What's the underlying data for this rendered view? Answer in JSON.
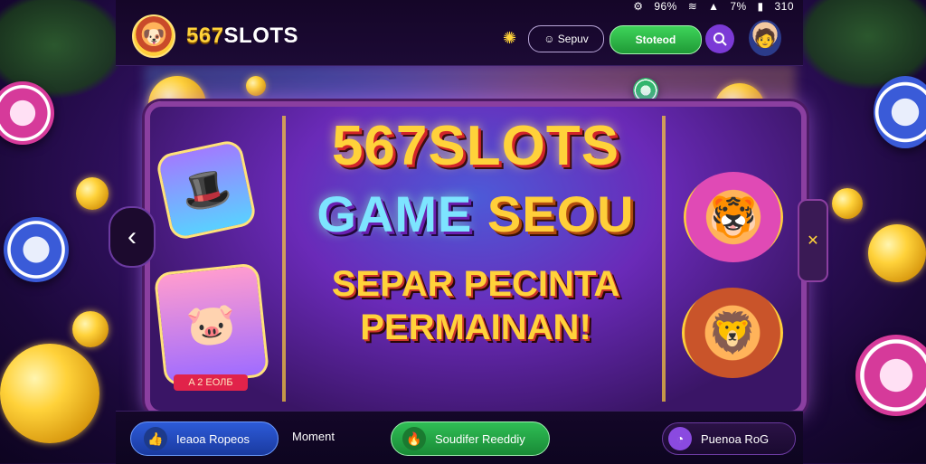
{
  "status_bar": {
    "icon1": "settings-cog-icon",
    "value1": "96%",
    "wifi_icon": "wifi-icon",
    "signal_icon": "signal-icon",
    "value2": "7%",
    "battery_icon": "battery-icon",
    "time": "310"
  },
  "header": {
    "brand_number": "567",
    "brand_name": "SLOTS",
    "signup_label": "☺ Sepuv",
    "login_label": "Stoteod",
    "search_icon": "search-icon"
  },
  "banner": {
    "title_line1": "567SLOTS",
    "title_line2_part1": "GAME",
    "title_line2_part2": "SEOU",
    "title_line3": "SEPAR PECINTA",
    "title_line4": "PERMAINAN!",
    "mascot_tag": "A 2 ЕОЛБ"
  },
  "bottom_nav": {
    "item1_label": "Ieaoa Ropeos",
    "item2_label": "Moment",
    "item3_label": "Soudifer Reeddiy",
    "item4_label": "Puenoa RoG"
  },
  "colors": {
    "accent_gold": "#ffd23a",
    "login_green": "#2fbe55",
    "search_purple": "#7b3ad6",
    "promo_blue": "#2d5bd8"
  }
}
